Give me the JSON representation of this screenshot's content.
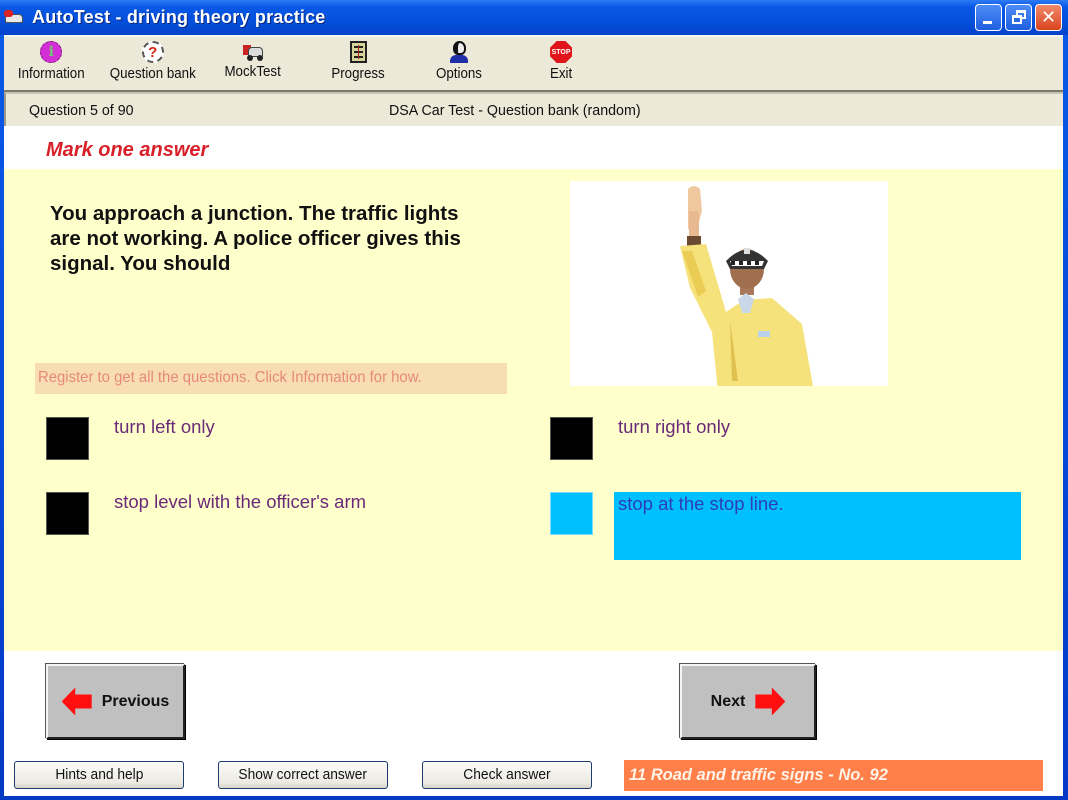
{
  "window": {
    "title": "AutoTest - driving theory practice",
    "app_icon": "car-app-icon",
    "controls": [
      "minimize",
      "restore",
      "close"
    ]
  },
  "toolbar": {
    "items": [
      {
        "label": "Information",
        "icon": "info-icon"
      },
      {
        "label": "Question bank",
        "icon": "question-icon"
      },
      {
        "label": "MockTest",
        "icon": "car-icon"
      },
      {
        "label": "Progress",
        "icon": "ledger-icon"
      },
      {
        "label": "Options",
        "icon": "person-icon"
      },
      {
        "label": "Exit",
        "icon": "stop-sign-icon",
        "icon_text": "STOP"
      }
    ]
  },
  "header": {
    "question_counter": "Question 5 of 90",
    "mode": "DSA Car Test - Question bank (random)"
  },
  "instruction": "Mark one answer",
  "question": {
    "text": "You approach a junction.  The traffic lights are not working.  A police officer gives this signal.  You should",
    "image_alt": "Police officer in yellow jacket with right arm raised straight up",
    "register_notice": "Register to get all the questions. Click Information for how."
  },
  "answers": [
    {
      "text": "turn left only",
      "selected": false
    },
    {
      "text": "turn right only",
      "selected": false
    },
    {
      "text": "stop level with the officer's arm",
      "selected": false
    },
    {
      "text": "stop at the stop line.",
      "selected": true
    }
  ],
  "navigation": {
    "previous_label": "Previous",
    "next_label": "Next"
  },
  "footer": {
    "hints_label": "Hints and help",
    "show_correct_label": "Show correct answer",
    "check_label": "Check answer",
    "category": "11  Road and traffic signs - No. 92"
  },
  "colors": {
    "question_bg": "#ffffcc",
    "selected_answer": "#00bfff",
    "instruction_text": "#d8202a",
    "category_bg": "#ff7f4a",
    "answer_text": "#6a2a78"
  }
}
